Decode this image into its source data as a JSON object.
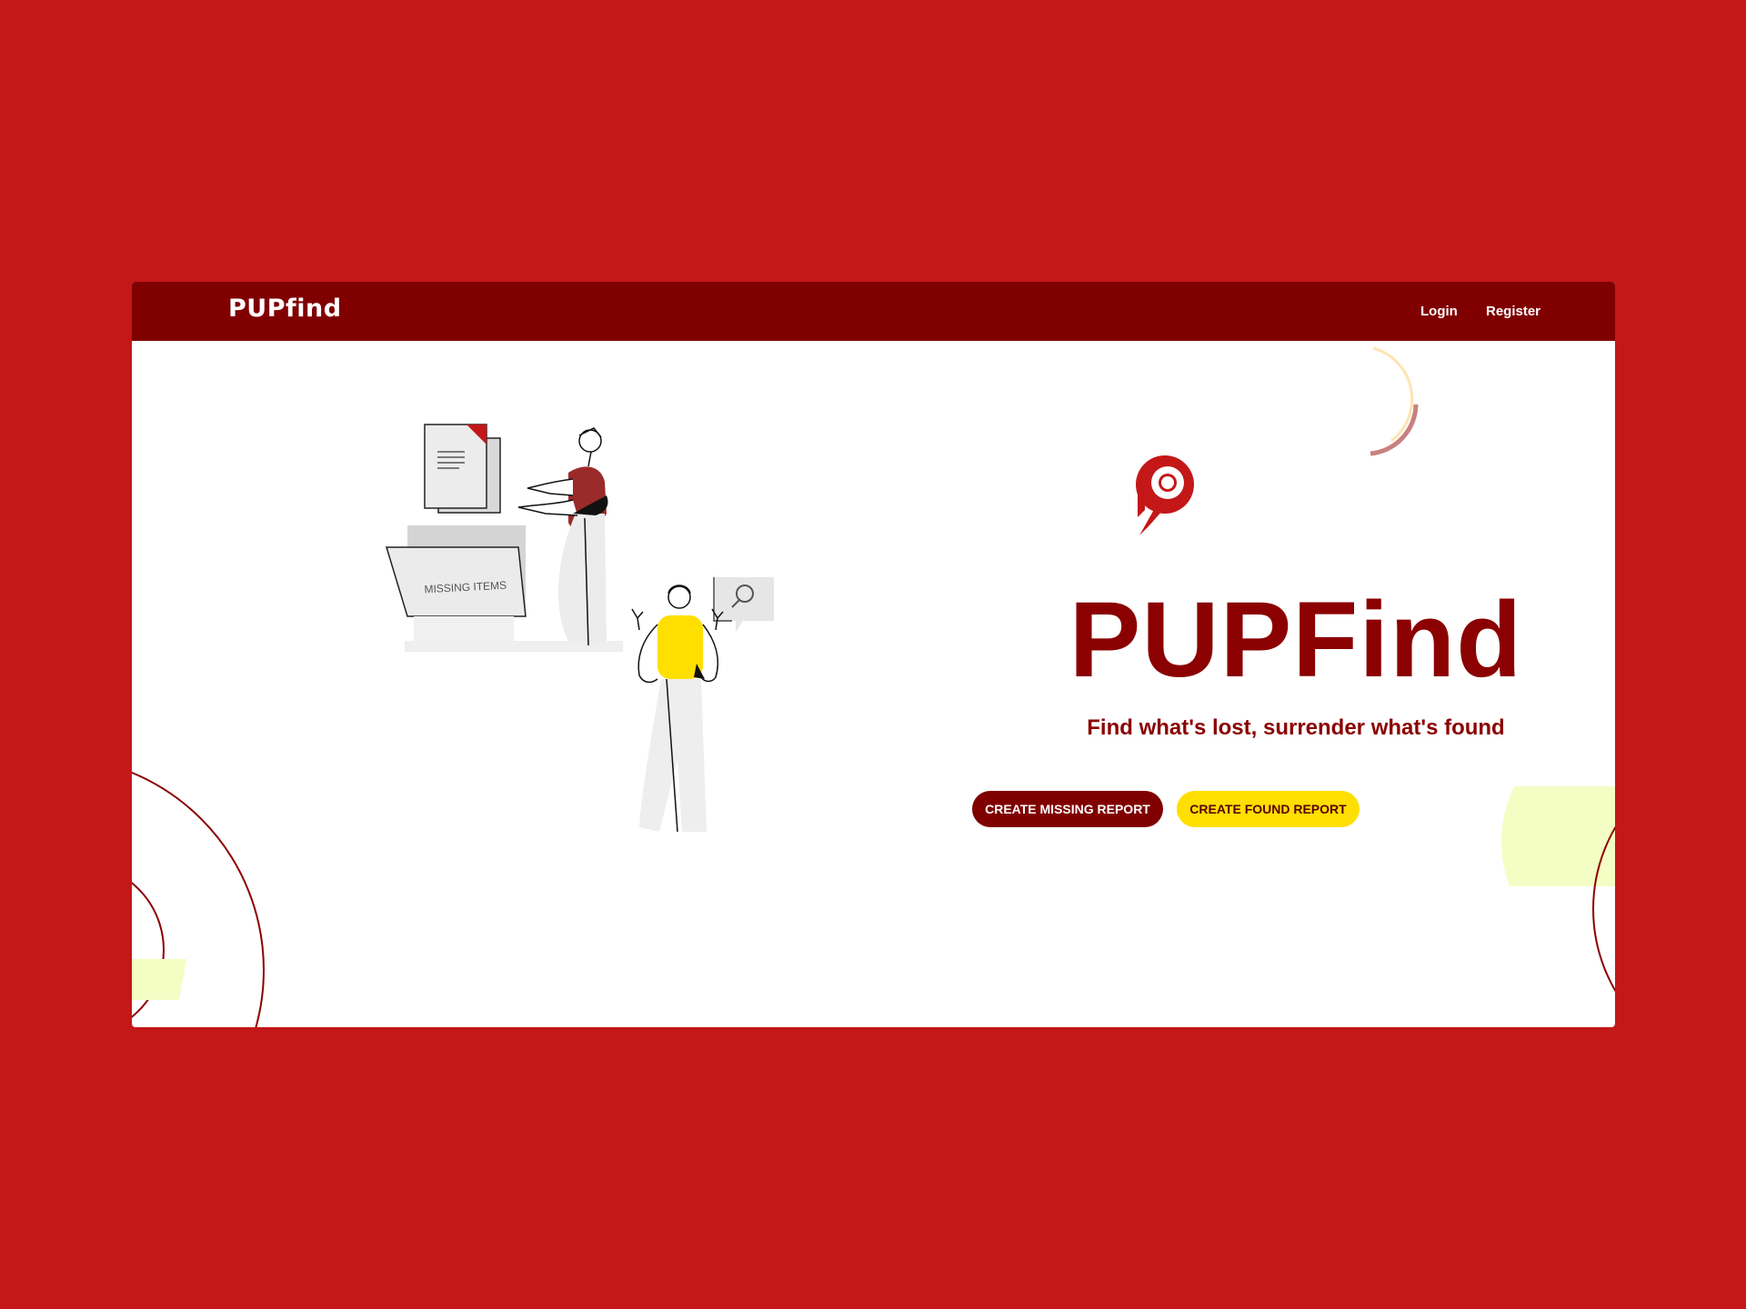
{
  "navbar": {
    "brand": "PUPfind",
    "links": [
      "Login",
      "Register"
    ]
  },
  "hero": {
    "title": "PUPFind",
    "subtitle": "Find what's lost, surrender what's found",
    "buttons": {
      "missing": "CREATE MISSING REPORT",
      "found": "CREATE FOUND REPORT"
    }
  },
  "illustration": {
    "folder_label": "MISSING ITEMS"
  },
  "colors": {
    "background": "#c41718",
    "navbar": "#800000",
    "primary": "#8b0000",
    "accent_yellow": "#ffdf00"
  },
  "icons": [
    "pupfind-logo-icon",
    "search-icon",
    "document-icon"
  ]
}
